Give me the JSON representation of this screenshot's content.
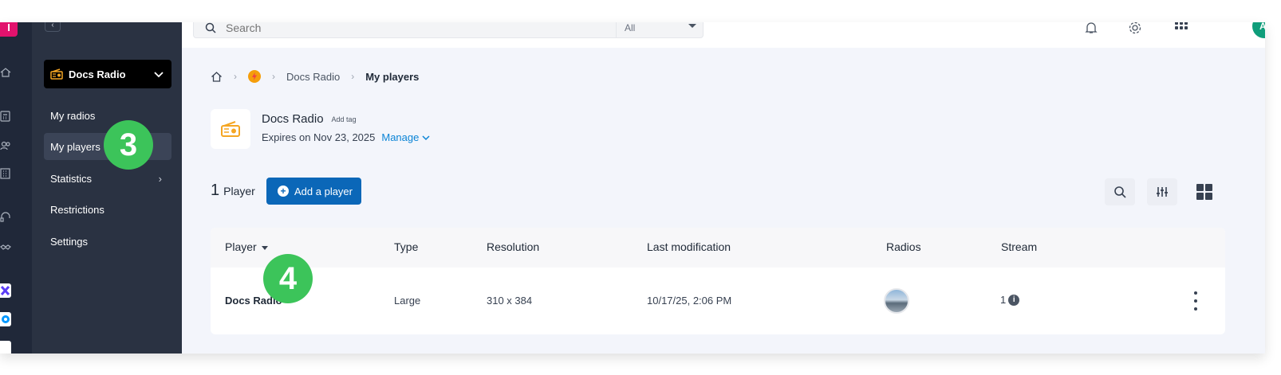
{
  "rail": {
    "logo_letter": "I"
  },
  "sidebar": {
    "product_name": "Docs Radio",
    "items": [
      {
        "label": "My radios"
      },
      {
        "label": "My players"
      },
      {
        "label": "Statistics"
      },
      {
        "label": "Restrictions"
      },
      {
        "label": "Settings"
      }
    ]
  },
  "topbar": {
    "search_placeholder": "Search",
    "search_scope": "All",
    "avatar_initials": "AI"
  },
  "breadcrumb": {
    "product": "Docs Radio",
    "current": "My players"
  },
  "product": {
    "name": "Docs Radio",
    "tag_link": "Add tag",
    "expiry": "Expires on Nov 23, 2025",
    "manage_label": "Manage"
  },
  "players": {
    "count": "1",
    "count_unit": "Player",
    "add_button": "Add a player",
    "columns": [
      "Player",
      "Type",
      "Resolution",
      "Last modification",
      "Radios",
      "Stream"
    ],
    "rows": [
      {
        "name": "Docs Radio",
        "type": "Large",
        "resolution": "310 x 384",
        "modified": "10/17/25, 2:06 PM",
        "stream": "1"
      }
    ]
  },
  "annotations": {
    "step_sidebar": "3",
    "step_table": "4"
  },
  "colors": {
    "primary": "#0b67b8",
    "link": "#0b84d6",
    "badge": "#3cc45a",
    "sidebar": "#2a3242",
    "rail": "#202839",
    "brand": "#e2126d"
  }
}
